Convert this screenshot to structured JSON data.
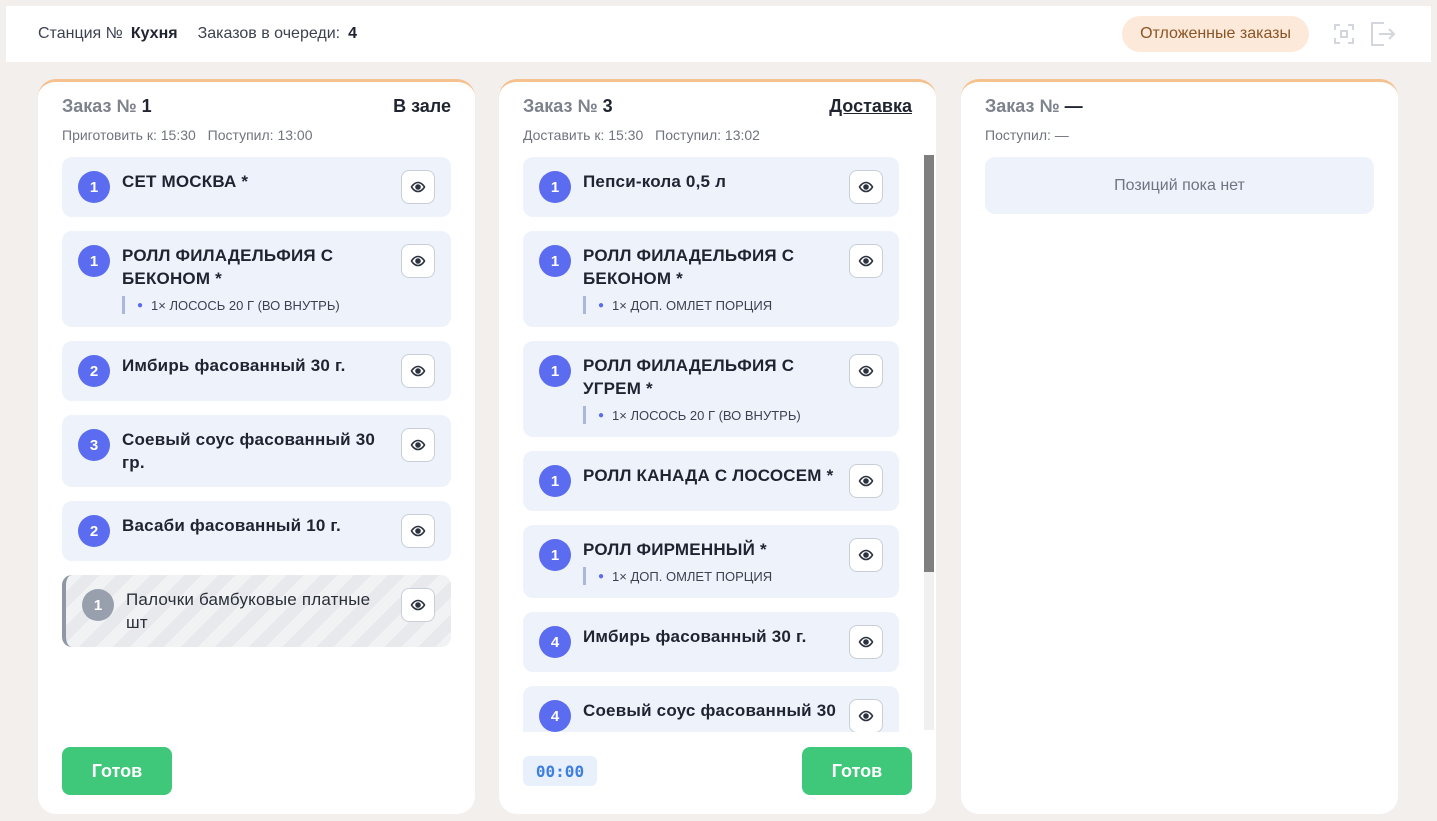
{
  "header": {
    "station_label": "Станция №",
    "station_value": "Кухня",
    "queue_label": "Заказов в очереди:",
    "queue_value": "4",
    "deferred_button": "Отложенные заказы",
    "fullscreen_icon": "fullscreen-icon",
    "logout_icon": "logout-icon"
  },
  "colors": {
    "badge": "#5b6cf0",
    "ready": "#3fc87a",
    "card_accent": "#f4c18f",
    "deferred_bg": "#fde9d9"
  },
  "orders": [
    {
      "title_prefix": "Заказ №",
      "number": "1",
      "type": "В зале",
      "meta1": "Приготовить к: 15:30",
      "meta2": "Поступил: 13:00",
      "items": [
        {
          "qty": "1",
          "name": "СЕТ МОСКВА *"
        },
        {
          "qty": "1",
          "name": "РОЛЛ ФИЛАДЕЛЬФИЯ С БЕКОНОМ *",
          "mod": "1× ЛОСОСЬ 20 Г (ВО ВНУТРЬ)"
        },
        {
          "qty": "2",
          "name": "Имбирь фасованный 30 г."
        },
        {
          "qty": "3",
          "name": "Соевый соус фасованный 30 гр."
        },
        {
          "qty": "2",
          "name": "Васаби фасованный 10 г."
        },
        {
          "qty": "1",
          "name": "Палочки бамбуковые платные шт",
          "done": true
        }
      ],
      "ready_button": "Готов"
    },
    {
      "title_prefix": "Заказ №",
      "number": "3",
      "type": "Доставка",
      "meta1": "Доставить к: 15:30",
      "meta2": "Поступил: 13:02",
      "items": [
        {
          "qty": "1",
          "name": "Пепси-кола 0,5 л"
        },
        {
          "qty": "1",
          "name": "РОЛЛ ФИЛАДЕЛЬФИЯ С БЕКОНОМ *",
          "mod": "1× ДОП. ОМЛЕТ ПОРЦИЯ"
        },
        {
          "qty": "1",
          "name": "РОЛЛ ФИЛАДЕЛЬФИЯ С УГРЕМ *",
          "mod": "1× ЛОСОСЬ 20 Г (ВО ВНУТРЬ)"
        },
        {
          "qty": "1",
          "name": "РОЛЛ КАНАДА С ЛОСОСЕМ *"
        },
        {
          "qty": "1",
          "name": "РОЛЛ ФИРМЕННЫЙ *",
          "mod": "1× ДОП. ОМЛЕТ ПОРЦИЯ"
        },
        {
          "qty": "4",
          "name": "Имбирь фасованный 30 г."
        },
        {
          "qty": "4",
          "name": "Соевый соус фасованный 30"
        }
      ],
      "timer": "00:00",
      "ready_button": "Готов"
    },
    {
      "title_prefix": "Заказ №",
      "number": "—",
      "meta2": "Поступил: —",
      "empty_text": "Позиций пока нет"
    }
  ]
}
